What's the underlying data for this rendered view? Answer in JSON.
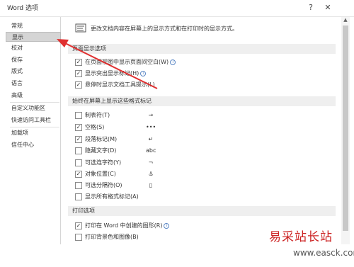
{
  "window": {
    "title": "Word 选项",
    "help": "?",
    "close": "✕"
  },
  "sidebar": {
    "items": [
      {
        "label": "常规"
      },
      {
        "label": "显示"
      },
      {
        "label": "校对"
      },
      {
        "label": "保存"
      },
      {
        "label": "版式"
      },
      {
        "label": "语言"
      },
      {
        "label": "高级"
      },
      {
        "label": "自定义功能区"
      },
      {
        "label": "快速访问工具栏"
      },
      {
        "label": "加载项"
      },
      {
        "label": "信任中心"
      }
    ]
  },
  "main": {
    "description": "更改文档内容在屏幕上的显示方式和在打印时的显示方式。",
    "sections": [
      {
        "title": "页面显示选项"
      },
      {
        "title": "始终在屏幕上显示这些格式标记"
      },
      {
        "title": "打印选项"
      }
    ],
    "page_options": [
      {
        "label": "在页面视图中显示页面间空白(W)",
        "checked": true,
        "info": "i"
      },
      {
        "label": "显示突出显示标记(H)",
        "checked": true,
        "info": "i"
      },
      {
        "label": "悬停时显示文档工具提示(L)",
        "checked": true,
        "info": ""
      }
    ],
    "format_marks": [
      {
        "label": "制表符(T)",
        "checked": false,
        "symbol": "→"
      },
      {
        "label": "空格(S)",
        "checked": true,
        "symbol": "•••"
      },
      {
        "label": "段落标记(M)",
        "checked": true,
        "symbol": "↵"
      },
      {
        "label": "隐藏文字(D)",
        "checked": false,
        "symbol": "abc"
      },
      {
        "label": "可选连字符(Y)",
        "checked": false,
        "symbol": "¬"
      },
      {
        "label": "对象位置(C)",
        "checked": true,
        "symbol": "⚓"
      },
      {
        "label": "可选分隔符(O)",
        "checked": false,
        "symbol": "▯"
      },
      {
        "label": "显示所有格式标记(A)",
        "checked": false,
        "symbol": ""
      }
    ],
    "print_options": [
      {
        "label": "打印在 Word 中创建的图形(R)",
        "checked": true,
        "info": "i"
      },
      {
        "label": "打印背景色和图像(B)",
        "checked": false,
        "info": ""
      }
    ],
    "check_mark": "✓"
  },
  "watermark": {
    "text": "易采站长站",
    "url": "www.easck.com"
  },
  "colors": {
    "arrow": "#e03030",
    "active_nav": "#d5d5d5",
    "section_bg": "#efefef"
  }
}
